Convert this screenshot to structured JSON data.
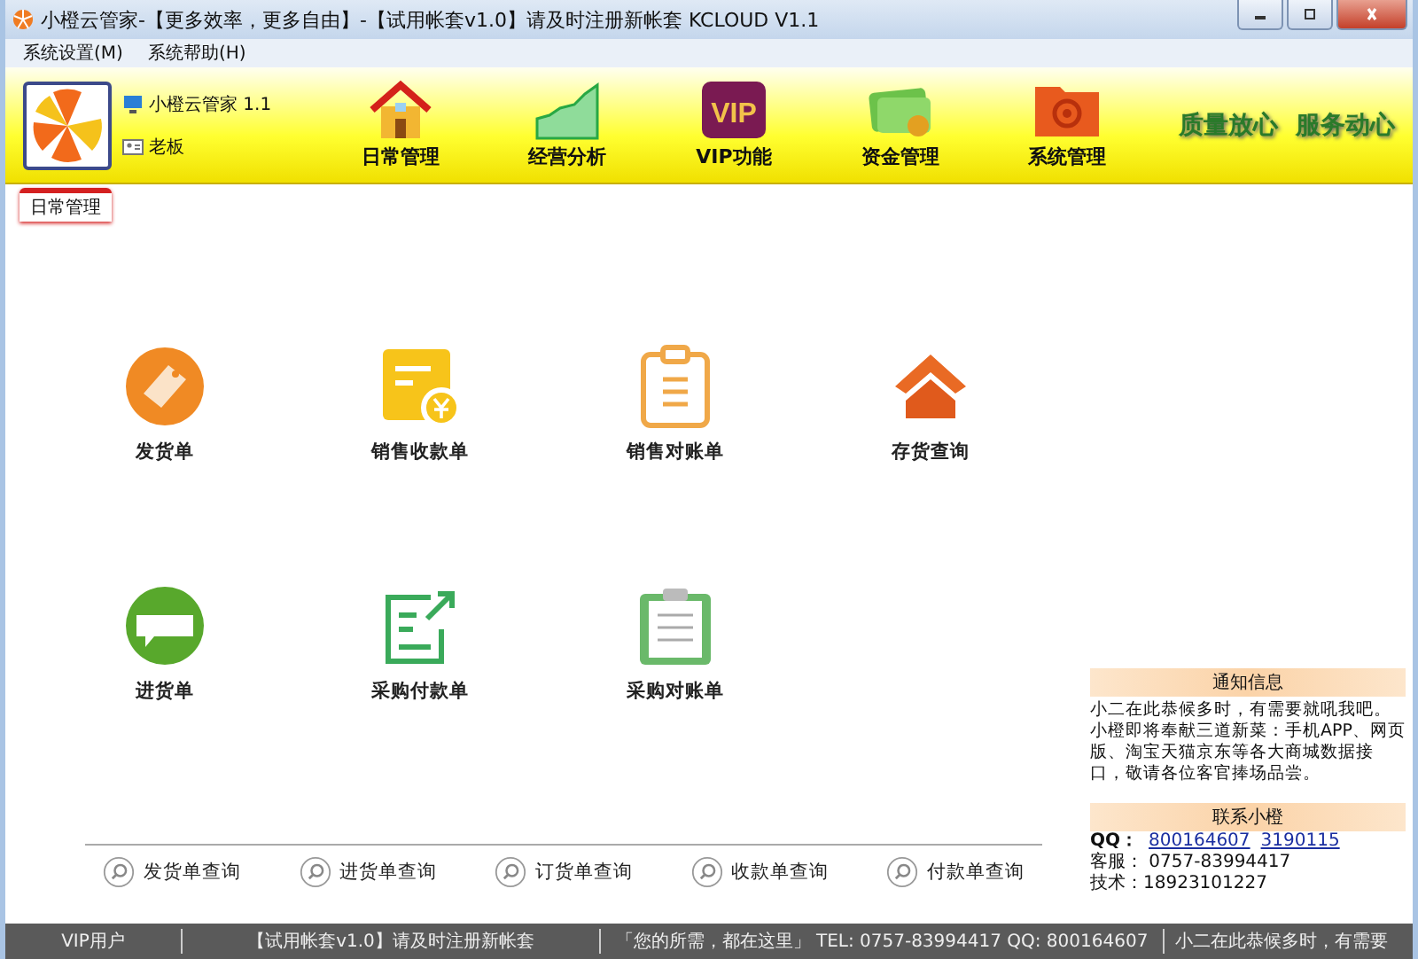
{
  "window": {
    "title": "小橙云管家-【更多效率，更多自由】-【试用帐套v1.0】请及时注册新帐套  KCLOUD V1.1"
  },
  "menu": [
    "系统设置(M)",
    "系统帮助(H)"
  ],
  "user": {
    "app": "小橙云管家 1.1",
    "role": "老板"
  },
  "toolbar": [
    {
      "kind": "home",
      "label": "日常管理"
    },
    {
      "kind": "chart",
      "label": "经营分析"
    },
    {
      "kind": "vip",
      "label": "VIP功能",
      "icon_text": "VIP"
    },
    {
      "kind": "money",
      "label": "资金管理"
    },
    {
      "kind": "system",
      "label": "系统管理"
    }
  ],
  "slogans": [
    "质量放心",
    "服务动心"
  ],
  "tabs": [
    {
      "label": "日常管理",
      "selected": true
    }
  ],
  "tiles": [
    {
      "kind": "sale",
      "label": "发货单"
    },
    {
      "kind": "receipt",
      "label": "销售收款单"
    },
    {
      "kind": "clipboard",
      "label": "销售对账单"
    },
    {
      "kind": "stock",
      "label": "存货查询"
    },
    {
      "kind": "buy",
      "label": "进货单"
    },
    {
      "kind": "payment",
      "label": "采购付款单"
    },
    {
      "kind": "checklist",
      "label": "采购对账单"
    }
  ],
  "queries": [
    "发货单查询",
    "进货单查询",
    "订货单查询",
    "收款单查询",
    "付款单查询"
  ],
  "notice": {
    "title": "通知信息",
    "text": "小二在此恭候多时，有需要就吼我吧。小橙即将奉献三道新菜：手机APP、网页版、淘宝天猫京东等各大商城数据接口，敬请各位客官捧场品尝。"
  },
  "contact": {
    "title": "联系小橙",
    "qq_label": "QQ：",
    "qq": [
      "800164607",
      "3190115"
    ],
    "service": "客服： 0757-83994417",
    "tech": "技术：18923101227"
  },
  "status_bar": [
    "VIP用户",
    "【试用帐套v1.0】请及时注册新帐套",
    "「您的所需，都在这里」 TEL: 0757-83994417  QQ: 800164607",
    "小二在此恭候多时，有需要"
  ]
}
